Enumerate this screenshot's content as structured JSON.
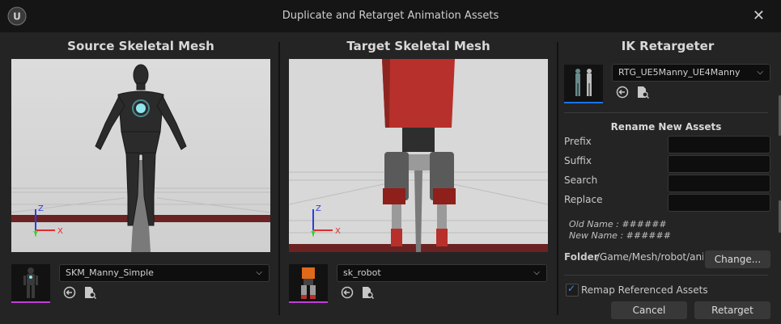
{
  "window": {
    "title": "Duplicate and Retarget Animation Assets",
    "close_glyph": "✕",
    "logo_glyph": "U"
  },
  "source": {
    "heading": "Source Skeletal Mesh",
    "mesh": "SKM_Manny_Simple",
    "thumb_accent": "#c23fd7",
    "axis": {
      "z": "Z",
      "y": "Y",
      "x": "X"
    }
  },
  "target": {
    "heading": "Target Skeletal Mesh",
    "mesh": "sk_robot",
    "thumb_accent": "#c23fd7",
    "axis": {
      "z": "Z",
      "y": "Y",
      "x": "X"
    }
  },
  "ik": {
    "heading": "IK Retargeter",
    "asset": "RTG_UE5Manny_UE4Manny",
    "thumb_accent": "#1a73e8"
  },
  "rename": {
    "heading": "Rename New Assets",
    "prefix_label": "Prefix",
    "suffix_label": "Suffix",
    "search_label": "Search",
    "replace_label": "Replace",
    "prefix_value": "",
    "suffix_value": "",
    "search_value": "",
    "replace_value": "",
    "old_name": "Old Name : ######",
    "new_name": "New Name : ######"
  },
  "folder": {
    "label": "Folder",
    "path": "/Game/Mesh/robot/ani",
    "change_label": "Change..."
  },
  "remap": {
    "label": "Remap Referenced Assets",
    "checked": true,
    "check_glyph": "✓"
  },
  "actions": {
    "cancel": "Cancel",
    "retarget": "Retarget"
  },
  "colors": {
    "accent": "#1a73e8",
    "ground_red": "#6b2222",
    "viewport_bg": "#d8d8d8"
  }
}
